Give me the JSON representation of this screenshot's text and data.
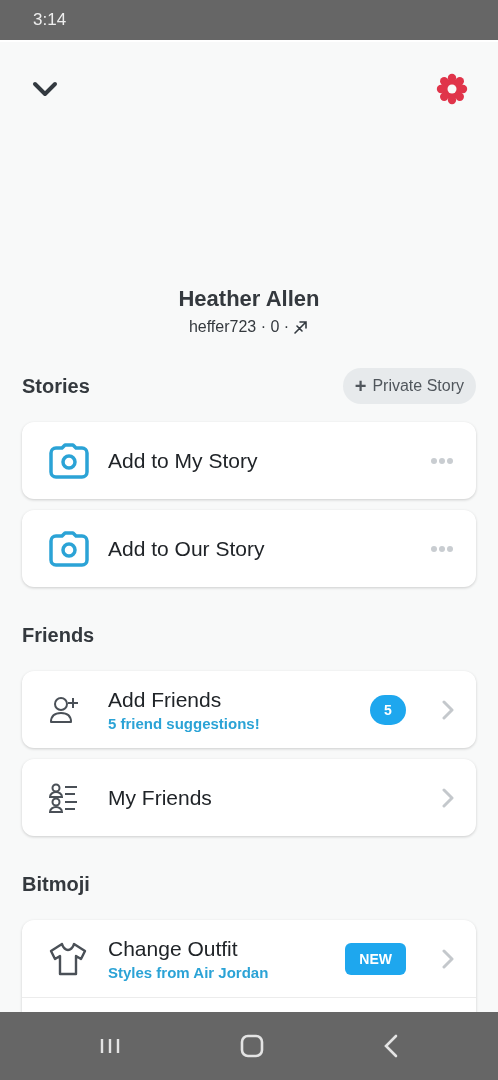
{
  "status_bar": {
    "time": "3:14"
  },
  "profile": {
    "name": "Heather Allen",
    "handle": "heffer723 · 0 ·"
  },
  "sections": [
    {
      "title": "Stories",
      "action": {
        "label": "Private Story",
        "icon": "+"
      },
      "items": [
        {
          "kind": "story",
          "title": "Add to My Story"
        },
        {
          "kind": "story",
          "title": "Add to Our Story"
        }
      ]
    },
    {
      "title": "Friends",
      "items": [
        {
          "kind": "add-friends",
          "title": "Add Friends",
          "subtitle": "5 friend suggestions!",
          "badge": {
            "kind": "count",
            "text": "5"
          }
        },
        {
          "kind": "friends-list",
          "title": "My Friends"
        }
      ]
    },
    {
      "title": "Bitmoji",
      "items": [
        {
          "kind": "outfit",
          "title": "Change Outfit",
          "subtitle": "Styles from Air Jordan",
          "badge": {
            "kind": "tag",
            "text": "NEW"
          },
          "continues": true
        }
      ]
    }
  ]
}
